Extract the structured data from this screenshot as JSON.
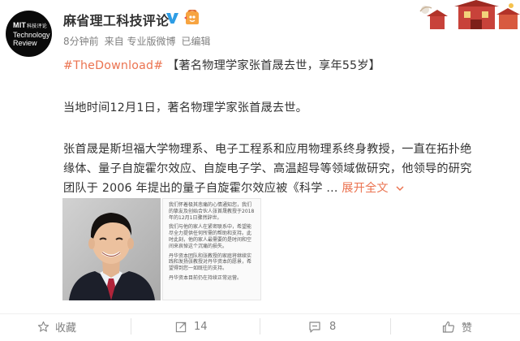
{
  "account": {
    "name": "麻省理工科技评论",
    "avatar_line1": "MIT",
    "avatar_line1_small": "科技评论",
    "avatar_line2": "Technology",
    "avatar_line3": "Review"
  },
  "meta": {
    "time": "8分钟前",
    "source": "来自 专业版微博",
    "edited": "已编辑"
  },
  "post": {
    "hashtag": "#TheDownload#",
    "headline": "【著名物理学家张首晟去世，享年55岁】",
    "para1": "当地时间12月1日，著名物理学家张首晟去世。",
    "para2_line1": "张首晟是斯坦福大学物理系、电子工程系和应用物理系终身教授，一直在拓扑绝",
    "para2_line2": "缘体、量子自旋霍尔效应、自旋电子学、高温超导等领域做研究，他领导的研究",
    "para2_line3": "团队于 2006 年提出的量子自旋霍尔效应被《科学 ...",
    "expand_label": "展开全文"
  },
  "doc_image": {
    "p1": "我们怀着极其悲痛的心情通知您，我们的挚友及创始合伙人张首晟教授于2018年的12月1日骤然辞世。",
    "p2": "我们与他的家人在紧密联系中，希望能尽全力提供任何所需的帮助和支持。此时此刻，他的家人最需要的是时间和空间来哀悼这个沉痛的损失。",
    "p3": "丹华资本团队和张教授的家庭将继续实践和发扬张教授对丹华资本的愿景，希望得到您一如既往的支持。",
    "p4": "丹华资本目前仍在持续正常运营。"
  },
  "actions": {
    "favorite_label": "收藏",
    "repost_count": "14",
    "comment_count": "8",
    "like_label": "赞"
  },
  "colors": {
    "accent": "#eb7350",
    "verified_blue": "#2e9de5",
    "text": "#333333",
    "meta": "#808080"
  }
}
